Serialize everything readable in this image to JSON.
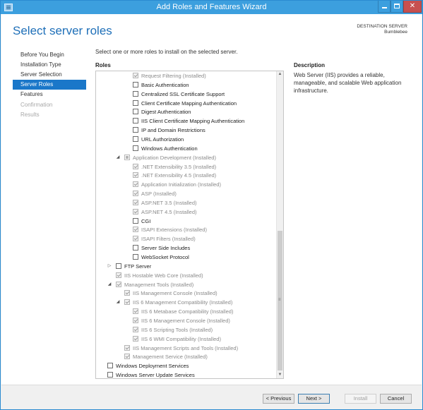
{
  "window": {
    "title": "Add Roles and Features Wizard",
    "minimize_label": "",
    "maximize_label": "",
    "close_label": "✕"
  },
  "header": {
    "page_title": "Select server roles",
    "destination_label": "DESTINATION SERVER",
    "destination_name": "Bumblebee"
  },
  "nav": {
    "items": [
      {
        "label": "Before You Begin",
        "state": "normal"
      },
      {
        "label": "Installation Type",
        "state": "normal"
      },
      {
        "label": "Server Selection",
        "state": "normal"
      },
      {
        "label": "Server Roles",
        "state": "active"
      },
      {
        "label": "Features",
        "state": "normal"
      },
      {
        "label": "Confirmation",
        "state": "disabled"
      },
      {
        "label": "Results",
        "state": "disabled"
      }
    ]
  },
  "main": {
    "instruction": "Select one or more roles to install on the selected server.",
    "roles_label": "Roles",
    "description_label": "Description",
    "description_text": "Web Server (IIS) provides a reliable, manageable, and scalable Web application infrastructure."
  },
  "roles_tree": [
    {
      "label": "Request Filtering (Installed)",
      "state": "checked-dis",
      "indent": 3,
      "expander": ""
    },
    {
      "label": "Basic Authentication",
      "state": "unchecked",
      "indent": 3,
      "expander": ""
    },
    {
      "label": "Centralized SSL Certificate Support",
      "state": "unchecked",
      "indent": 3,
      "expander": ""
    },
    {
      "label": "Client Certificate Mapping Authentication",
      "state": "unchecked",
      "indent": 3,
      "expander": ""
    },
    {
      "label": "Digest Authentication",
      "state": "unchecked",
      "indent": 3,
      "expander": ""
    },
    {
      "label": "IIS Client Certificate Mapping Authentication",
      "state": "unchecked",
      "indent": 3,
      "expander": ""
    },
    {
      "label": "IP and Domain Restrictions",
      "state": "unchecked",
      "indent": 3,
      "expander": ""
    },
    {
      "label": "URL Authorization",
      "state": "unchecked",
      "indent": 3,
      "expander": ""
    },
    {
      "label": "Windows Authentication",
      "state": "unchecked",
      "indent": 3,
      "expander": ""
    },
    {
      "label": "Application Development (Installed)",
      "state": "partial-dis",
      "indent": 2,
      "expander": "◢"
    },
    {
      "label": ".NET Extensibility 3.5 (Installed)",
      "state": "checked-dis",
      "indent": 3,
      "expander": ""
    },
    {
      "label": ".NET Extensibility 4.5 (Installed)",
      "state": "checked-dis",
      "indent": 3,
      "expander": ""
    },
    {
      "label": "Application Initialization (Installed)",
      "state": "checked-dis",
      "indent": 3,
      "expander": ""
    },
    {
      "label": "ASP (Installed)",
      "state": "checked-dis",
      "indent": 3,
      "expander": ""
    },
    {
      "label": "ASP.NET 3.5 (Installed)",
      "state": "checked-dis",
      "indent": 3,
      "expander": ""
    },
    {
      "label": "ASP.NET 4.5 (Installed)",
      "state": "checked-dis",
      "indent": 3,
      "expander": ""
    },
    {
      "label": "CGI",
      "state": "unchecked",
      "indent": 3,
      "expander": ""
    },
    {
      "label": "ISAPI Extensions (Installed)",
      "state": "checked-dis",
      "indent": 3,
      "expander": ""
    },
    {
      "label": "ISAPI Filters (Installed)",
      "state": "checked-dis",
      "indent": 3,
      "expander": ""
    },
    {
      "label": "Server Side Includes",
      "state": "unchecked",
      "indent": 3,
      "expander": ""
    },
    {
      "label": "WebSocket Protocol",
      "state": "unchecked",
      "indent": 3,
      "expander": ""
    },
    {
      "label": "FTP Server",
      "state": "unchecked",
      "indent": 1,
      "expander": "▷"
    },
    {
      "label": "IIS Hostable Web Core (Installed)",
      "state": "checked-dis",
      "indent": 1,
      "expander": ""
    },
    {
      "label": "Management Tools (Installed)",
      "state": "checked-dis",
      "indent": 1,
      "expander": "◢"
    },
    {
      "label": "IIS Management Console (Installed)",
      "state": "checked-dis",
      "indent": 2,
      "expander": ""
    },
    {
      "label": "IIS 6 Management Compatibility (Installed)",
      "state": "checked-dis",
      "indent": 2,
      "expander": "◢"
    },
    {
      "label": "IIS 6 Metabase Compatibility (Installed)",
      "state": "checked-dis",
      "indent": 3,
      "expander": ""
    },
    {
      "label": "IIS 6 Management Console (Installed)",
      "state": "checked-dis",
      "indent": 3,
      "expander": ""
    },
    {
      "label": "IIS 6 Scripting Tools (Installed)",
      "state": "checked-dis",
      "indent": 3,
      "expander": ""
    },
    {
      "label": "IIS 6 WMI Compatibility (Installed)",
      "state": "checked-dis",
      "indent": 3,
      "expander": ""
    },
    {
      "label": "IIS Management Scripts and Tools (Installed)",
      "state": "checked-dis",
      "indent": 2,
      "expander": ""
    },
    {
      "label": "Management Service (Installed)",
      "state": "checked-dis",
      "indent": 2,
      "expander": ""
    },
    {
      "label": "Windows Deployment Services",
      "state": "unchecked",
      "indent": 0,
      "expander": ""
    },
    {
      "label": "Windows Server Update Services",
      "state": "unchecked",
      "indent": 0,
      "expander": ""
    }
  ],
  "scrollbar": {
    "up_arrow": "▲",
    "down_arrow": "▼",
    "grip": "≡"
  },
  "footer": {
    "previous_label": "< Previous",
    "next_label": "Next >",
    "install_label": "Install",
    "cancel_label": "Cancel"
  },
  "colors": {
    "titlebar": "#3c9fde",
    "page_title": "#1e6fb8",
    "nav_active": "#1a77c9",
    "close_button": "#c75050"
  }
}
